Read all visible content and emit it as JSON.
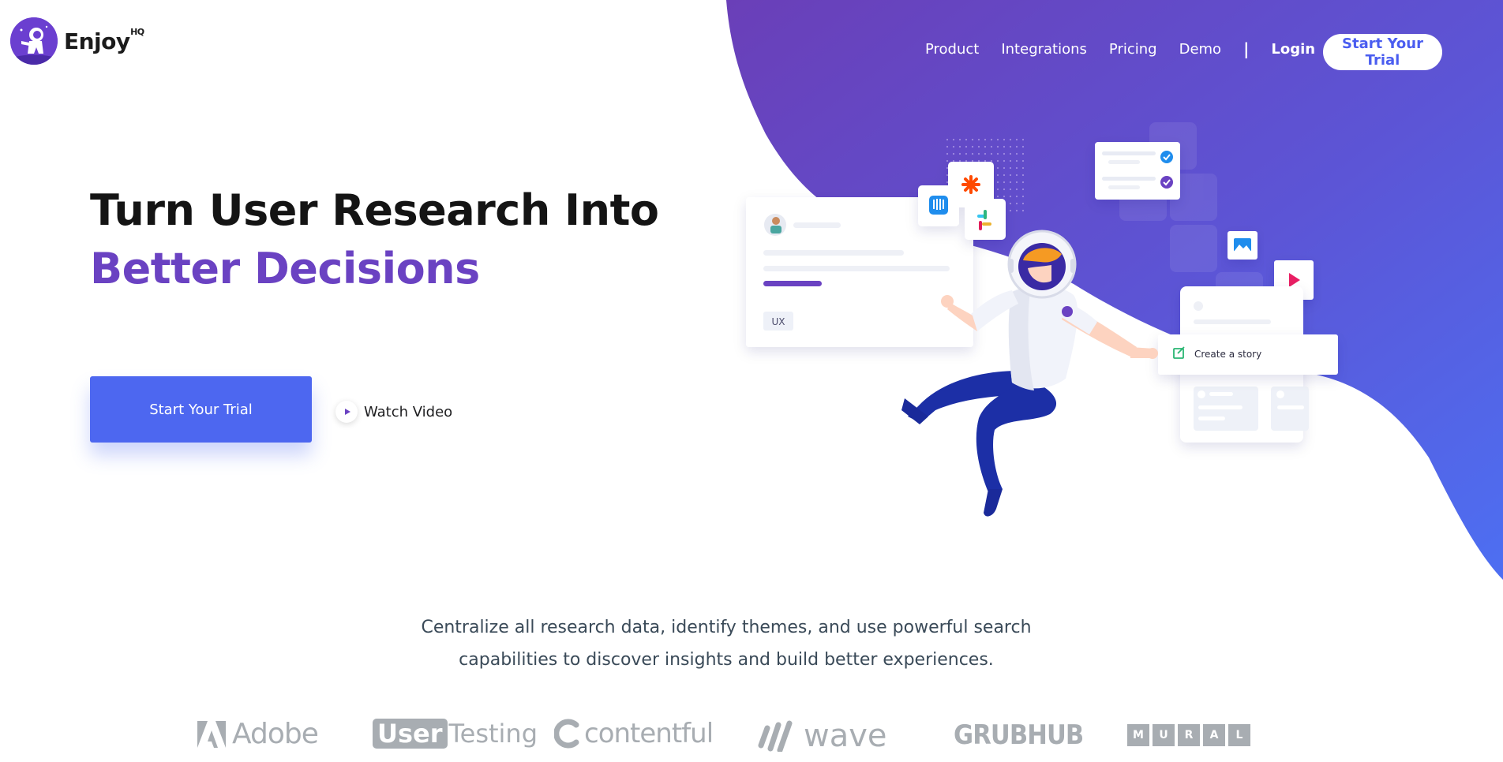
{
  "brand": {
    "name": "Enjoy",
    "suffix": "HQ"
  },
  "nav": {
    "items": [
      "Product",
      "Integrations",
      "Pricing",
      "Demo"
    ],
    "separator": "|",
    "login": "Login",
    "cta": "Start Your Trial"
  },
  "hero": {
    "title_line1": "Turn User Research Into",
    "title_line2": "Better Decisions",
    "cta": "Start Your Trial",
    "watch_video": "Watch Video"
  },
  "illustration": {
    "card_tag": "UX",
    "story_label": "Create a story"
  },
  "subtext": {
    "line1": "Centralize all research data, identify themes, and use powerful search",
    "line2": "capabilities to discover insights and build better experiences."
  },
  "logos": {
    "adobe": "Adobe",
    "usertesting_box": "User",
    "usertesting_rest": "Testing",
    "contentful": "contentful",
    "wave": "wave",
    "grubhub": "GRUBHUB",
    "mural": [
      "M",
      "U",
      "R",
      "A",
      "L"
    ]
  },
  "colors": {
    "primary": "#4d67f0",
    "brand_purple": "#6a42c2",
    "blob_start": "#6a3fb8",
    "blob_end": "#4f6af2"
  }
}
